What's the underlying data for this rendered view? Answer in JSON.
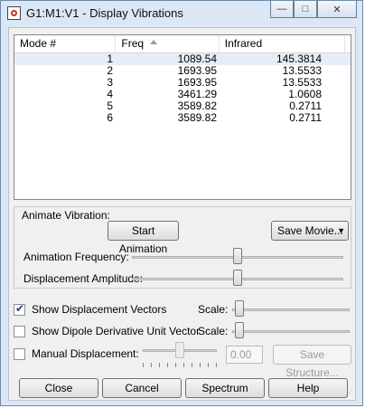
{
  "window": {
    "title": "G1:M1:V1 - Display Vibrations"
  },
  "caption_buttons": {
    "minimize": "—",
    "maximize": "□",
    "close": "✕"
  },
  "table": {
    "columns": [
      "Mode #",
      "Freq",
      "Infrared"
    ],
    "rows": [
      {
        "mode": "1",
        "freq": "1089.54",
        "ir": "145.3814"
      },
      {
        "mode": "2",
        "freq": "1693.95",
        "ir": "13.5533"
      },
      {
        "mode": "3",
        "freq": "1693.95",
        "ir": "13.5533"
      },
      {
        "mode": "4",
        "freq": "3461.29",
        "ir": "1.0608"
      },
      {
        "mode": "5",
        "freq": "3589.82",
        "ir": "0.2711"
      },
      {
        "mode": "6",
        "freq": "3589.82",
        "ir": "0.2711"
      }
    ]
  },
  "animate": {
    "group_label": "Animate Vibration:",
    "start_button": "Start Animation",
    "save_movie_button": "Save Movie...",
    "frequency_label": "Animation Frequency:",
    "amplitude_label": "Displacement Amplitude:",
    "frequency_level": 0.5,
    "amplitude_level": 0.5
  },
  "options": {
    "show_displacement_vectors": {
      "label": "Show Displacement Vectors",
      "checked": true,
      "scale_label": "Scale:",
      "scale_level": 0.02
    },
    "show_dipole_vector": {
      "label": "Show Dipole Derivative Unit Vector",
      "checked": false,
      "scale_label": "Scale:",
      "scale_level": 0.02
    },
    "manual_displacement": {
      "label": "Manual Displacement:",
      "checked": false,
      "value": "0.00",
      "save_structure_button": "Save Structure...",
      "level": 0.5
    }
  },
  "footer": {
    "close": "Close",
    "cancel": "Cancel",
    "spectrum": "Spectrum",
    "help": "Help"
  },
  "icons": {
    "app": "gaussview-app-icon",
    "sort": "sort-ascending-icon",
    "dropdown": "dropdown-arrow-icon",
    "checkmark": "checkmark-icon",
    "size_grip": "size-grip-icon"
  }
}
